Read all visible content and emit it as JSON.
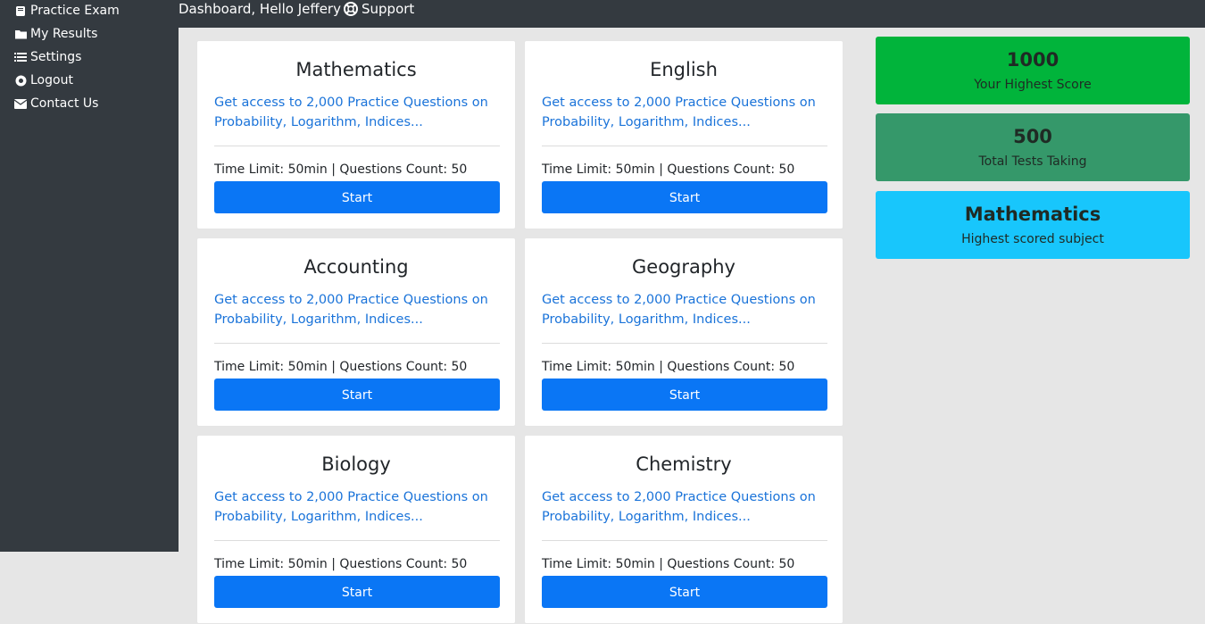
{
  "sidebar": {
    "items": [
      {
        "label": "Practice Exam",
        "icon": "book-icon"
      },
      {
        "label": "My Results",
        "icon": "folder-icon"
      },
      {
        "label": "Settings",
        "icon": "list-icon"
      },
      {
        "label": "Logout",
        "icon": "circle-dot-icon"
      },
      {
        "label": "Contact Us",
        "icon": "envelope-icon"
      }
    ]
  },
  "header": {
    "greeting": "Dashboard, Hello Jeffery",
    "support_label": "Support",
    "support_icon": "lifebuoy-icon"
  },
  "colors": {
    "sidebar_bg": "#343a40",
    "link_blue": "#1a73d9",
    "button_blue": "#0a76f5",
    "stat_green": "#01b43b",
    "stat_teal_green": "#35986a",
    "stat_cyan": "#18c6fc"
  },
  "exams": [
    {
      "title": "Mathematics",
      "description": "Get access to 2,000 Practice Questions on Probability, Logarithm, Indices...",
      "meta": "Time Limit: 50min | Questions Count: 50",
      "button": "Start"
    },
    {
      "title": "English",
      "description": "Get access to 2,000 Practice Questions on Probability, Logarithm, Indices...",
      "meta": "Time Limit: 50min | Questions Count: 50",
      "button": "Start"
    },
    {
      "title": "Accounting",
      "description": "Get access to 2,000 Practice Questions on Probability, Logarithm, Indices...",
      "meta": "Time Limit: 50min | Questions Count: 50",
      "button": "Start"
    },
    {
      "title": "Geography",
      "description": "Get access to 2,000 Practice Questions on Probability, Logarithm, Indices...",
      "meta": "Time Limit: 50min | Questions Count: 50",
      "button": "Start"
    },
    {
      "title": "Biology",
      "description": "Get access to 2,000 Practice Questions on Probability, Logarithm, Indices...",
      "meta": "Time Limit: 50min | Questions Count: 50",
      "button": "Start"
    },
    {
      "title": "Chemistry",
      "description": "Get access to 2,000 Practice Questions on Probability, Logarithm, Indices...",
      "meta": "Time Limit: 50min | Questions Count: 50",
      "button": "Start"
    }
  ],
  "stats": [
    {
      "value": "1000",
      "label": "Your Highest Score"
    },
    {
      "value": "500",
      "label": "Total Tests Taking"
    },
    {
      "value": "Mathematics",
      "label": "Highest scored subject"
    }
  ]
}
